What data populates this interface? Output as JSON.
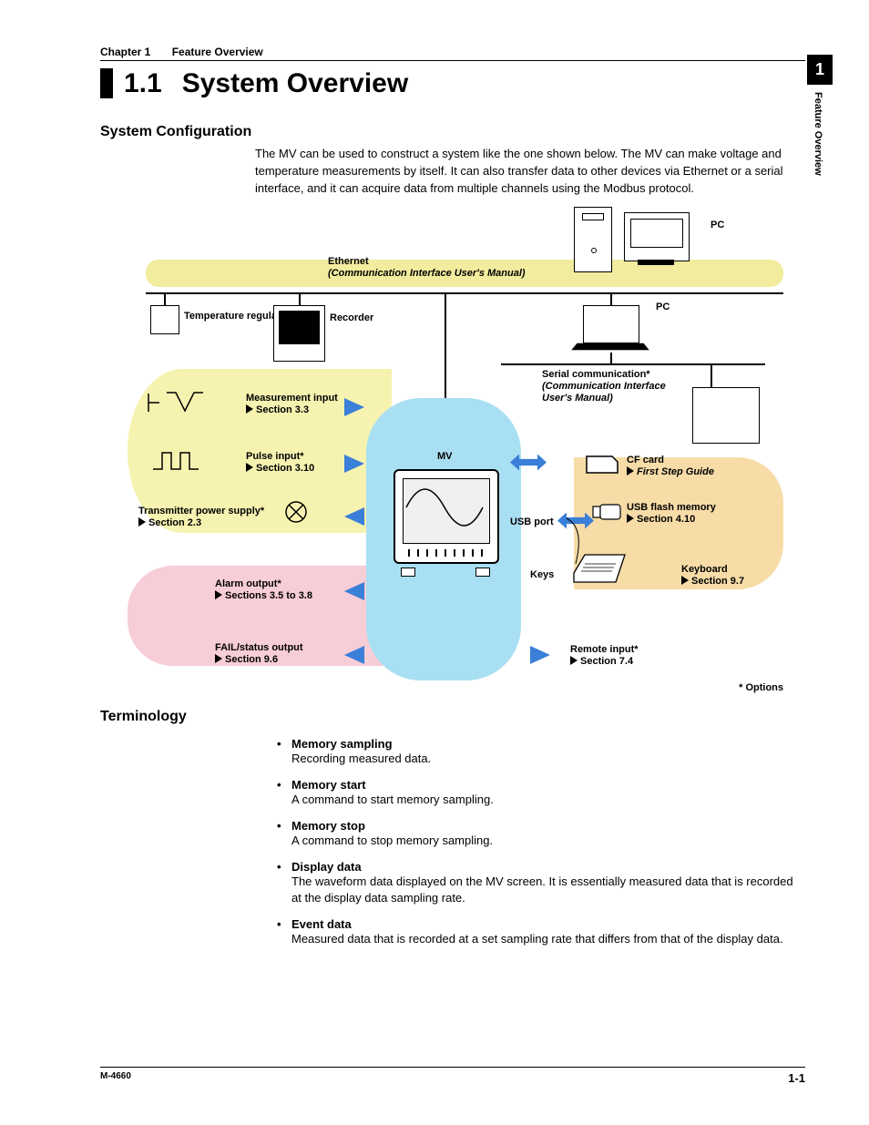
{
  "header": {
    "chapter": "Chapter 1",
    "chapter_title": "Feature Overview",
    "section_number": "1.1",
    "section_title": "System Overview"
  },
  "side_tab": {
    "number": "1",
    "label": "Feature Overview"
  },
  "system_config": {
    "heading": "System Configuration",
    "paragraph": "The MV can be used to construct a system like the one shown below. The MV can make voltage and temperature measurements by itself. It can also transfer data to other devices via Ethernet or a serial interface, and it can acquire data from multiple channels using the Modbus protocol."
  },
  "diagram": {
    "ethernet_label": "Ethernet",
    "ethernet_sub": "(Communication Interface User's Manual)",
    "pc": "PC",
    "temp_regulator": "Temperature regulator",
    "recorder": "Recorder",
    "serial_comm": "Serial communication*",
    "serial_sub": "(Communication Interface User's Manual)",
    "measurement_input": "Measurement input",
    "measurement_ref": "Section 3.3",
    "pulse_input": "Pulse input*",
    "pulse_ref": "Section 3.10",
    "transmitter": "Transmitter power supply*",
    "transmitter_ref": "Section 2.3",
    "alarm_output": "Alarm output*",
    "alarm_ref": "Sections 3.5 to 3.8",
    "fail_output": "FAIL/status output",
    "fail_ref": "Section 9.6",
    "mv_label": "MV",
    "usb_port": "USB port",
    "keys": "Keys",
    "cf_card": "CF card",
    "cf_ref": "First Step Guide",
    "usb_flash": "USB flash memory",
    "usb_ref": "Section 4.10",
    "keyboard": "Keyboard",
    "keyboard_ref": "Section 9.7",
    "remote_input": "Remote input*",
    "remote_ref": "Section 7.4",
    "options_note": "* Options"
  },
  "terminology": {
    "heading": "Terminology",
    "items": [
      {
        "term": "Memory sampling",
        "desc": "Recording measured data."
      },
      {
        "term": "Memory start",
        "desc": "A command to start memory sampling."
      },
      {
        "term": "Memory stop",
        "desc": "A command to stop memory sampling."
      },
      {
        "term": "Display data",
        "desc": "The waveform data displayed on the MV screen. It is essentially measured data that is recorded at the display data sampling rate."
      },
      {
        "term": "Event data",
        "desc": "Measured data that is recorded at a set sampling rate that differs from that of the display data."
      }
    ]
  },
  "footer": {
    "doc_id": "M-4660",
    "page_num": "1-1"
  }
}
